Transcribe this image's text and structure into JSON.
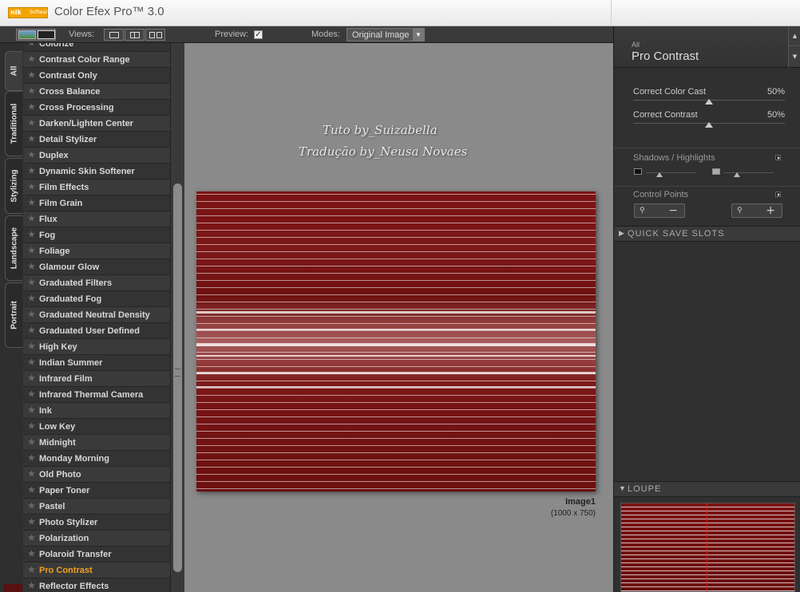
{
  "window": {
    "title": "Color Efex Pro™ 3.0",
    "logo_mark": "nik",
    "logo_sub": "Software"
  },
  "toolbar": {
    "views_label": "Views:",
    "preview_label": "Preview:",
    "preview_checked": "✓",
    "modes_label": "Modes:",
    "modes_value": "Original Image"
  },
  "tabs": [
    "All",
    "Traditional",
    "Stylizing",
    "Landscape",
    "Portrait"
  ],
  "filters": [
    "Colorize",
    "Contrast Color Range",
    "Contrast Only",
    "Cross Balance",
    "Cross Processing",
    "Darken/Lighten Center",
    "Detail Stylizer",
    "Duplex",
    "Dynamic Skin Softener",
    "Film Effects",
    "Film Grain",
    "Flux",
    "Fog",
    "Foliage",
    "Glamour Glow",
    "Graduated Filters",
    "Graduated Fog",
    "Graduated Neutral Density",
    "Graduated User Defined",
    "High Key",
    "Indian Summer",
    "Infrared Film",
    "Infrared Thermal Camera",
    "Ink",
    "Low Key",
    "Midnight",
    "Monday Morning",
    "Old Photo",
    "Paper Toner",
    "Pastel",
    "Photo Stylizer",
    "Polarization",
    "Polaroid Transfer",
    "Pro Contrast",
    "Reflector Effects"
  ],
  "selected_filter": "Pro Contrast",
  "preview": {
    "watermark_line1": "Tuto by_Suizabella",
    "watermark_line2": "Tradução by_Neusa Novaes",
    "image_name": "Image1",
    "image_dims": "(1000 x 750)"
  },
  "right_panel": {
    "category": "All",
    "filter_name": "Pro Contrast",
    "sliders": [
      {
        "label": "Correct Color Cast",
        "value_text": "50%",
        "value": 50
      },
      {
        "label": "Correct Contrast",
        "value_text": "50%",
        "value": 50
      }
    ],
    "shadows_highlights_label": "Shadows / Highlights",
    "control_points_label": "Control Points",
    "cp_minus": "−",
    "cp_plus": "+",
    "quick_save_label": "QUICK SAVE SLOTS",
    "loupe_label": "LOUPE"
  },
  "colors": {
    "selected_filter": "#f0a020",
    "image_base": "#7a1212"
  }
}
